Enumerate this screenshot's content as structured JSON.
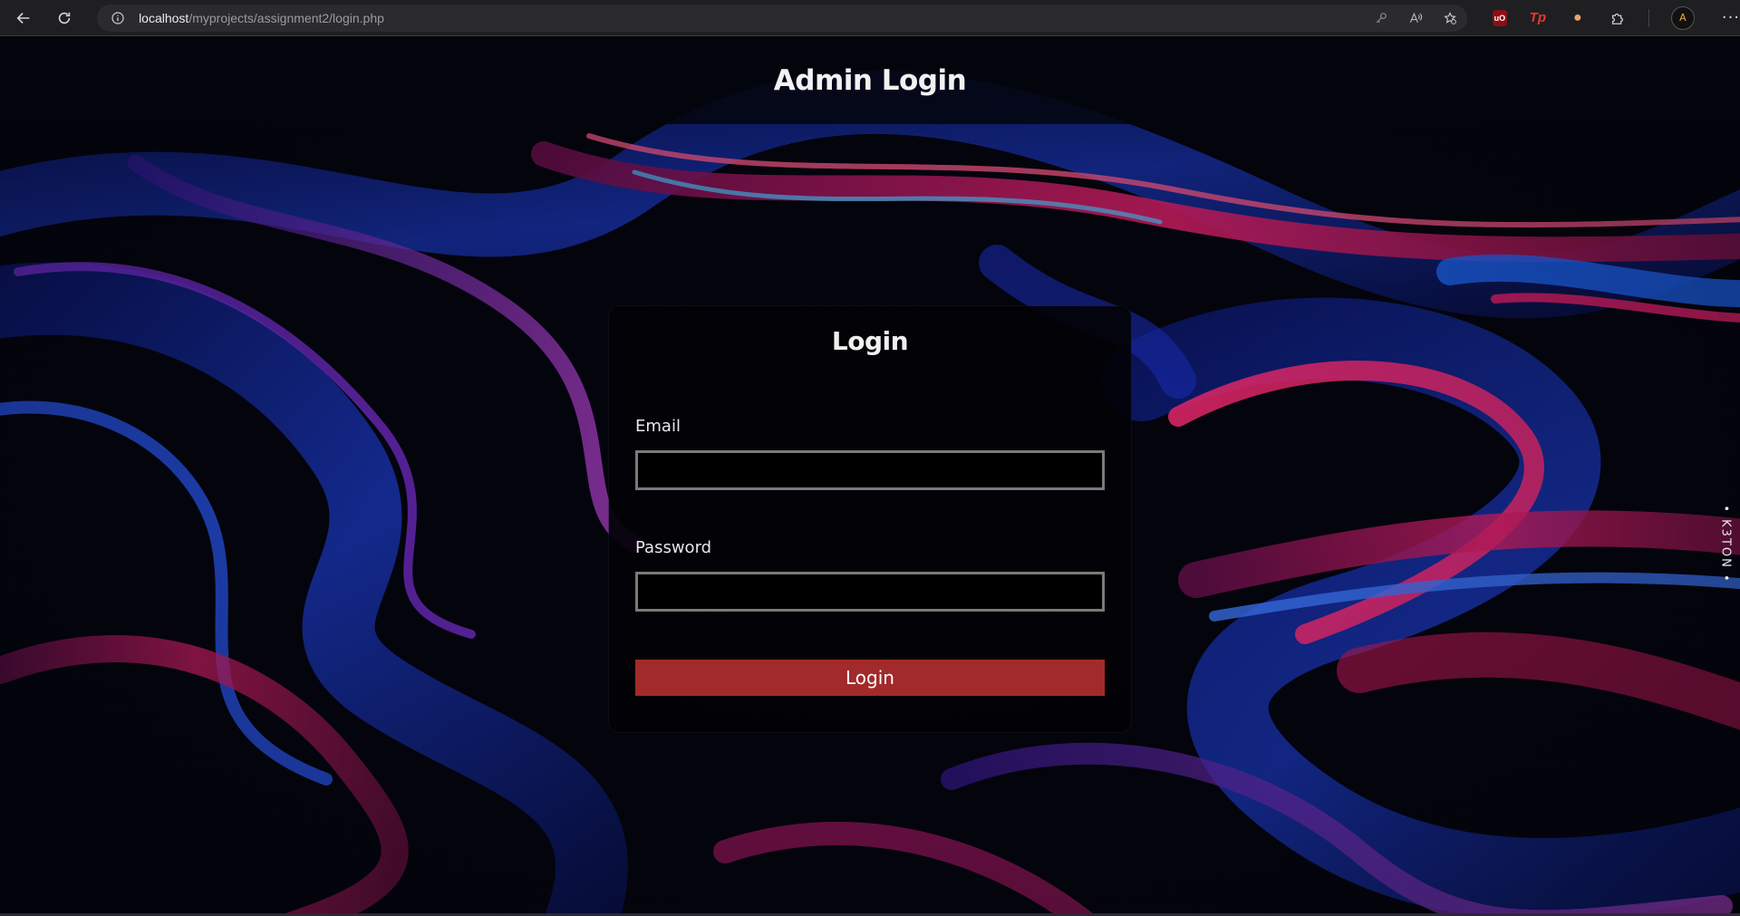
{
  "browser": {
    "url_host": "localhost",
    "url_path": "/myprojects/assignment2/login.php",
    "icons": [
      "back-icon",
      "refresh-icon",
      "site-info-icon",
      "key-icon",
      "read-aloud-icon",
      "favorite-icon",
      "ublock-icon",
      "tp-extension-icon",
      "slim-extension-icon",
      "extensions-icon",
      "profile-icon",
      "more-icon"
    ],
    "ext_ublock": "uO",
    "ext_tp": "Tp",
    "profile_initial": "A",
    "more": "···"
  },
  "header": {
    "title": "Admin Login"
  },
  "login_form": {
    "title": "Login",
    "email_label": "Email",
    "email_value": "",
    "password_label": "Password",
    "password_value": "",
    "submit_label": "Login"
  },
  "side_tab": {
    "label": "• K3TON •"
  },
  "colors": {
    "button": "#a22a2b",
    "card_bg": "#020206",
    "input_border": "#7a7a7a",
    "background_accent_blue": "#1d3fd8",
    "background_accent_pink": "#e0206a"
  }
}
